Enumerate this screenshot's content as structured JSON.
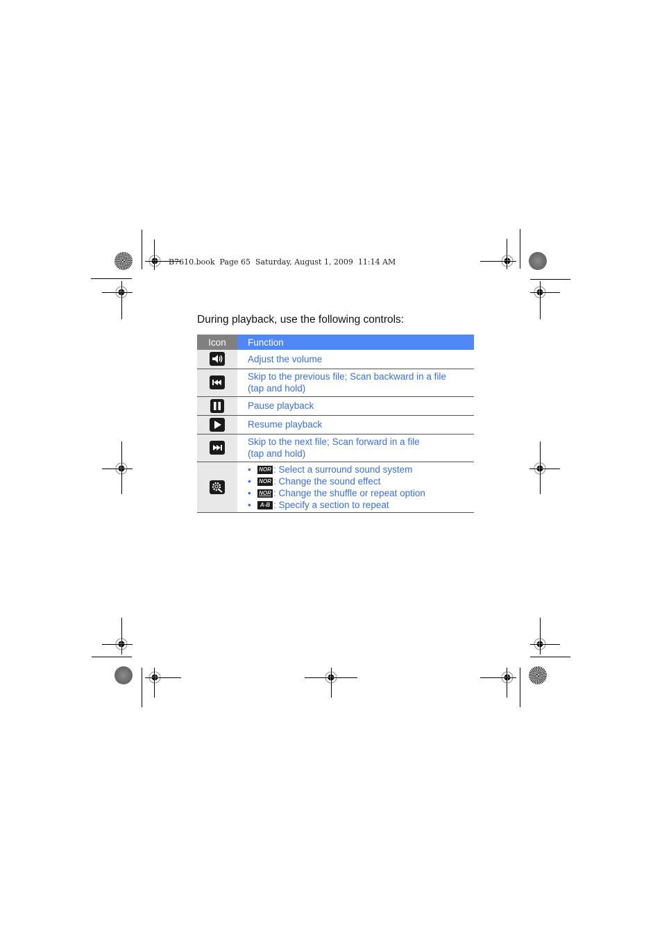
{
  "print_header": "B7610.book  Page 65  Saturday, August 1, 2009  11:14 AM",
  "intro_text": "During playback, use the following controls:",
  "table": {
    "headers": {
      "icon": "Icon",
      "function": "Function"
    },
    "rows": [
      {
        "icon": "volume-icon",
        "lines": [
          "Adjust the volume"
        ]
      },
      {
        "icon": "skip-previous-icon",
        "lines": [
          "Skip to the previous file; Scan backward in a file",
          "(tap and hold)"
        ]
      },
      {
        "icon": "pause-icon",
        "lines": [
          "Pause playback"
        ]
      },
      {
        "icon": "play-icon",
        "lines": [
          "Resume playback"
        ]
      },
      {
        "icon": "skip-next-icon",
        "lines": [
          "Skip to the next file; Scan forward in a file",
          "(tap and hold)"
        ]
      },
      {
        "icon": "settings-icon",
        "options": [
          {
            "badge": "NOR",
            "badge_icon": "surround-sound-icon",
            "text": ": Select a surround sound system"
          },
          {
            "badge": "NOR",
            "badge_icon": "sound-effect-icon",
            "text": ": Change the sound effect"
          },
          {
            "badge": "NOR",
            "badge_icon": "shuffle-repeat-icon",
            "text": ": Change the shuffle or repeat option"
          },
          {
            "badge": "A-B",
            "badge_icon": "ab-repeat-icon",
            "text": ": Specify a section to repeat"
          }
        ]
      }
    ]
  },
  "bullet_char": "•",
  "colors": {
    "header_icon_bg": "#808080",
    "header_function_bg": "#4f87f7",
    "link_text": "#3a6fe0",
    "icon_cell_bg": "#e8e8e8"
  }
}
